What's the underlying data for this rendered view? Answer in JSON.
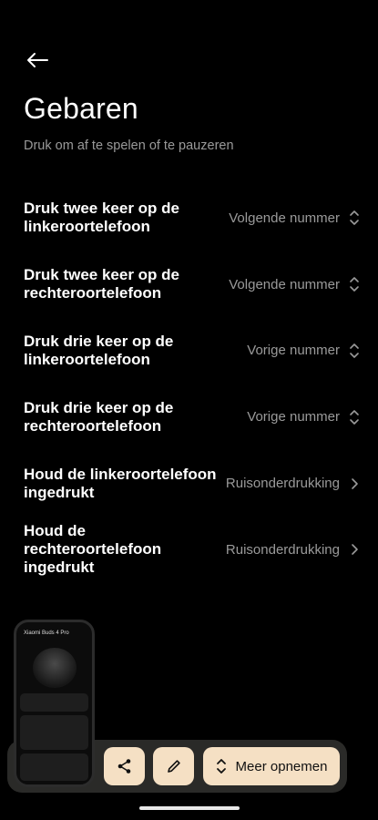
{
  "header": {
    "title": "Gebaren",
    "subtitle": "Druk om af te spelen of te pauzeren"
  },
  "gestures": [
    {
      "label": "Druk twee keer op de linkeroortelefoon",
      "value": "Volgende nummer",
      "icon": "up-down-chevron-icon"
    },
    {
      "label": "Druk twee keer op de rechteroortelefoon",
      "value": "Volgende nummer",
      "icon": "up-down-chevron-icon"
    },
    {
      "label": "Druk drie keer op de linkeroortelefoon",
      "value": "Vorige nummer",
      "icon": "up-down-chevron-icon"
    },
    {
      "label": "Druk drie keer op de rechteroortelefoon",
      "value": "Vorige nummer",
      "icon": "up-down-chevron-icon"
    },
    {
      "label": "Houd de linkeroortelefoon ingedrukt",
      "value": "Ruisonderdrukking",
      "icon": "chevron-right-icon"
    },
    {
      "label": "Houd de rechteroortelefoon ingedrukt",
      "value": "Ruisonderdrukking",
      "icon": "chevron-right-icon"
    }
  ],
  "recorder": {
    "thumbnail_title": "Xiaomi Buds 4 Pro",
    "more_label": "Meer opnemen"
  },
  "colors": {
    "background": "#000000",
    "secondary_text": "#9a9a9a",
    "button_bg": "#f5e0c4",
    "toolbar_bg": "#2a2a28"
  }
}
